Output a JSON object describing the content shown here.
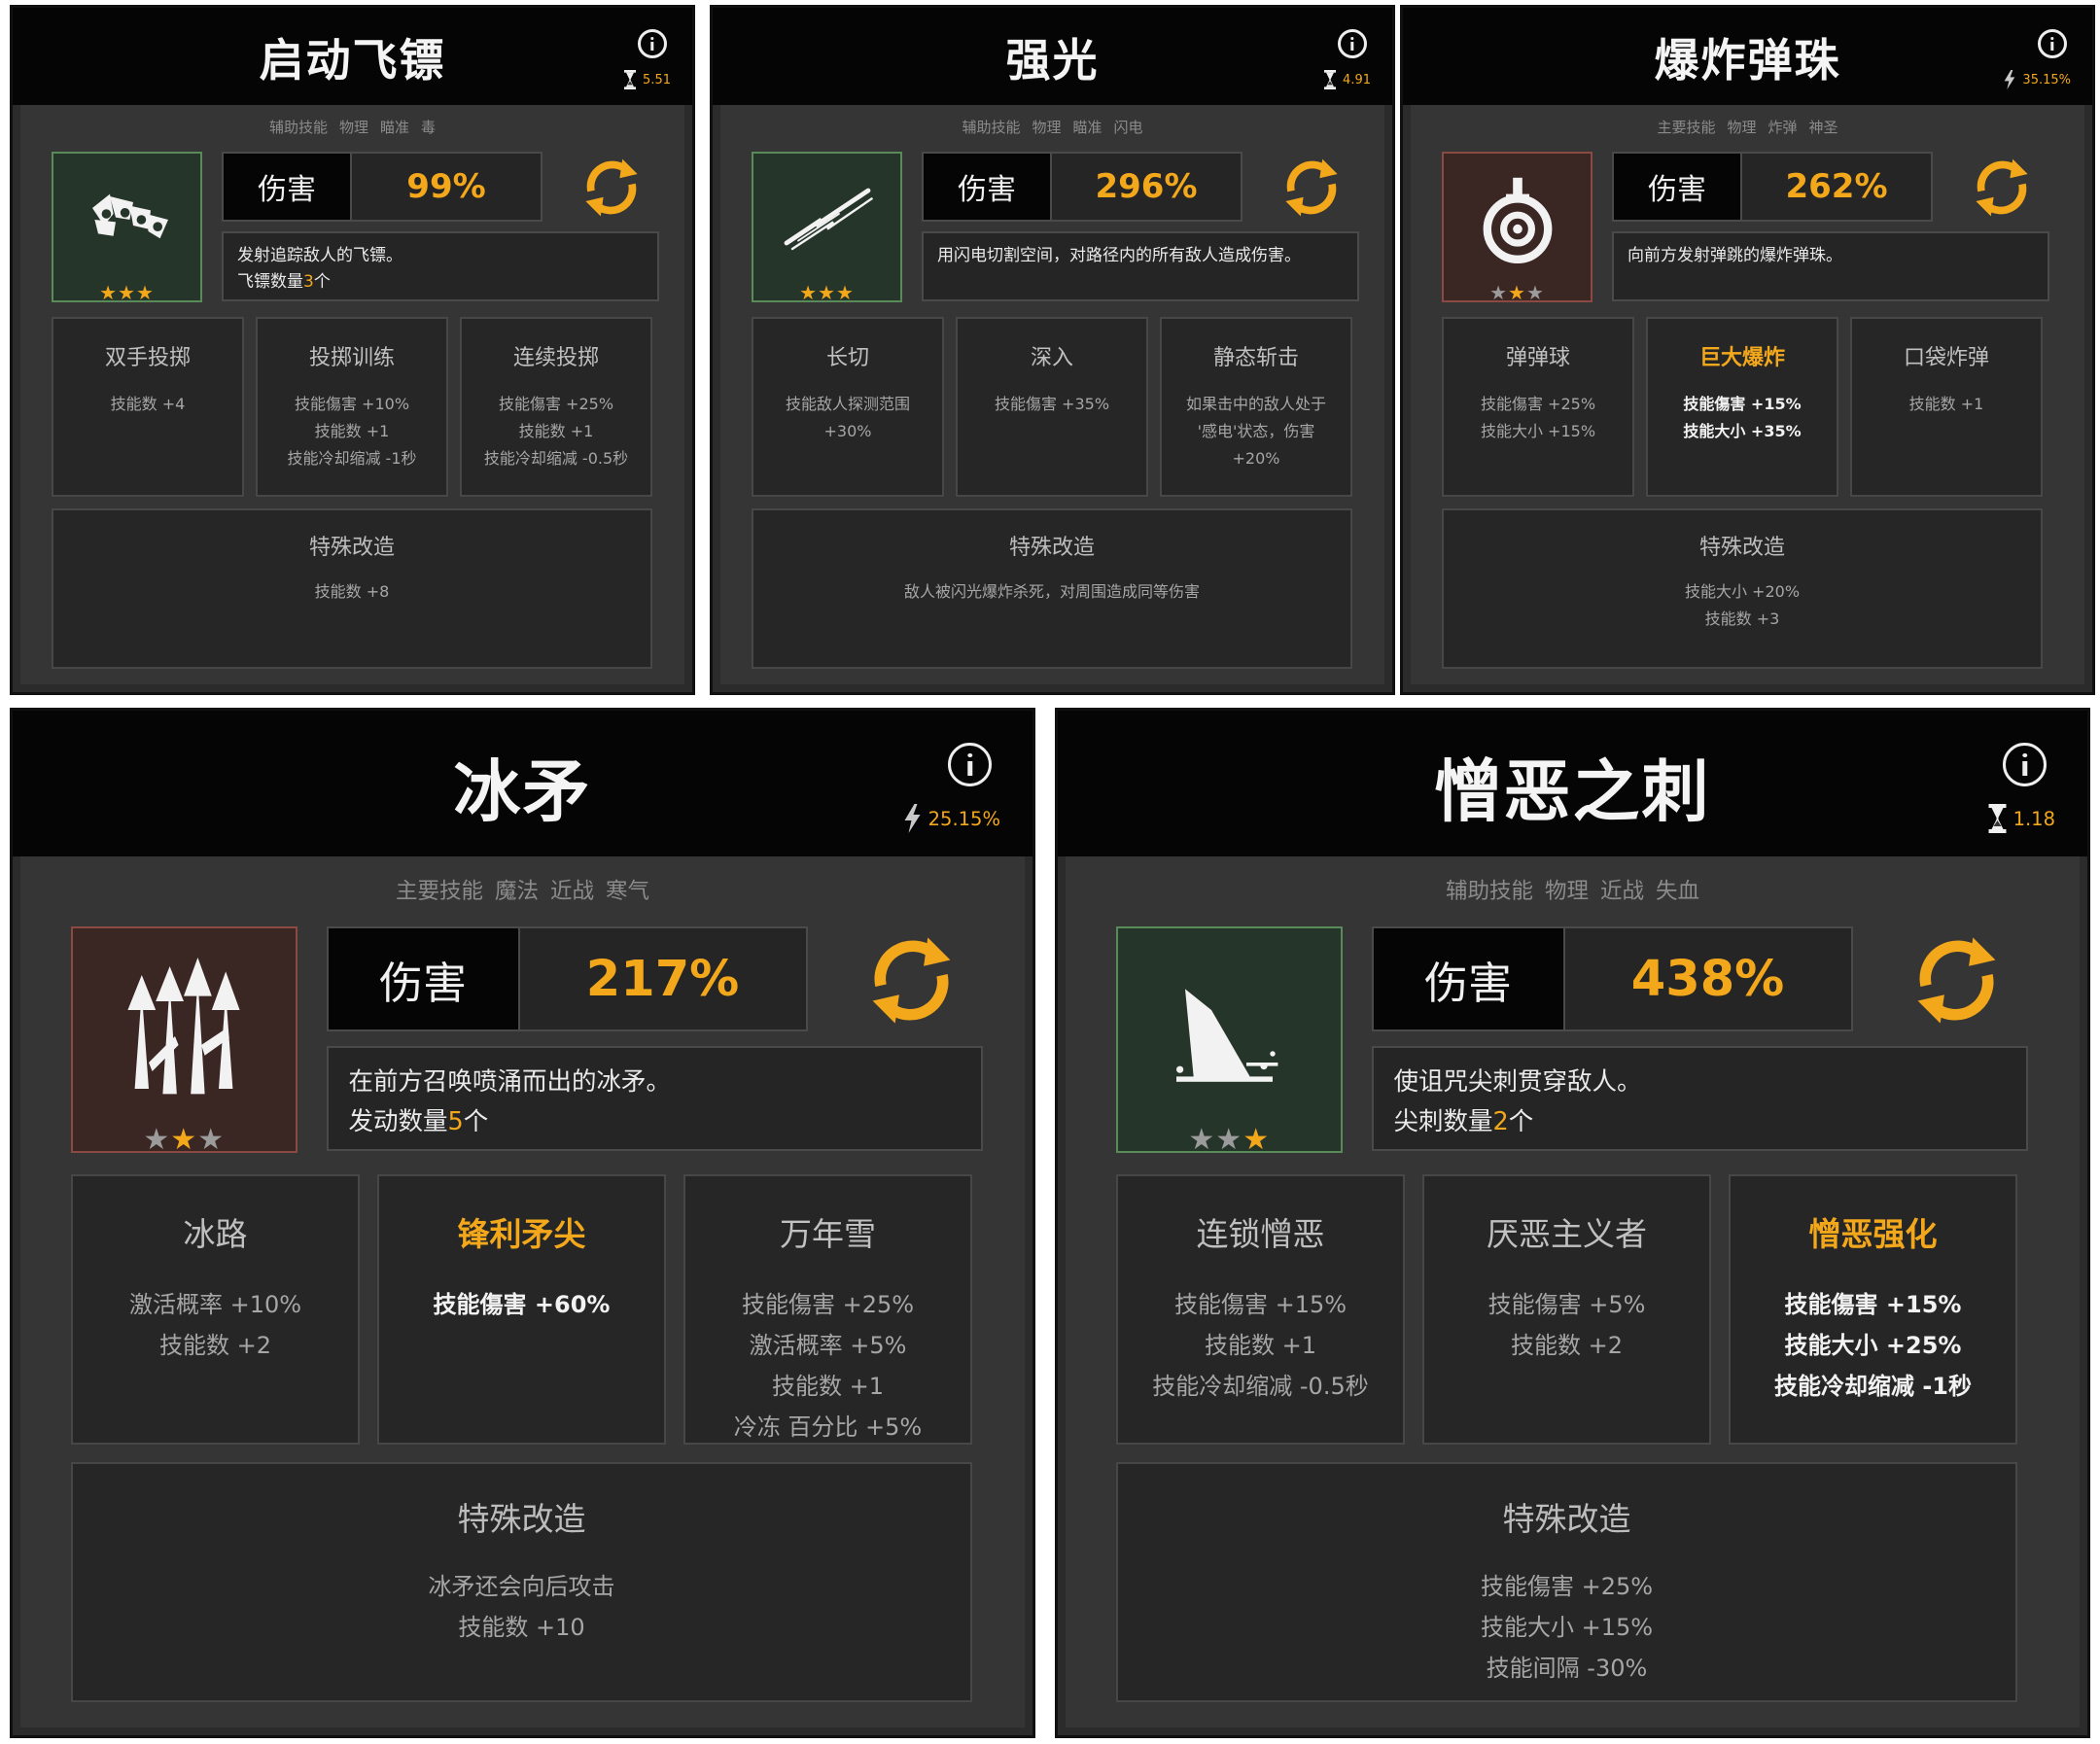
{
  "accent_color": "#f3a81c",
  "cards": [
    {
      "title": "启动飞镖",
      "stat_icon": "hourglass-icon",
      "stat_value": "5.51",
      "tags": [
        "辅助技能",
        "物理",
        "瞄准",
        "毒"
      ],
      "icon_name": "shuriken-icon",
      "icon_frame": "green",
      "stars": [
        true,
        true,
        true
      ],
      "damage_label": "伤害",
      "damage_value": "99%",
      "description": [
        "发射追踪敌人的飞镖。",
        "飞镖数量",
        "3",
        "个"
      ],
      "mods": [
        {
          "name": "双手投掷",
          "lines": [
            "技能数 +4"
          ],
          "highlight": false
        },
        {
          "name": "投掷训练",
          "lines": [
            "技能傷害 +10%",
            "技能数 +1",
            "技能冷却缩减 -1秒"
          ],
          "highlight": false
        },
        {
          "name": "连续投掷",
          "lines": [
            "技能傷害 +25%",
            "技能数 +1",
            "技能冷却缩减 -0.5秒"
          ],
          "highlight": false
        }
      ],
      "special_title": "特殊改造",
      "special_lines": [
        "技能数 +8"
      ]
    },
    {
      "title": "强光",
      "stat_icon": "hourglass-icon",
      "stat_value": "4.91",
      "tags": [
        "辅助技能",
        "物理",
        "瞄准",
        "闪电"
      ],
      "icon_name": "lightning-slash-icon",
      "icon_frame": "green",
      "stars": [
        true,
        true,
        true
      ],
      "damage_label": "伤害",
      "damage_value": "296%",
      "description": [
        "用闪电切割空间，对路径内的所有敌人造成伤害。"
      ],
      "mods": [
        {
          "name": "长切",
          "lines": [
            "技能敌人探测范围",
            "+30%"
          ],
          "highlight": false
        },
        {
          "name": "深入",
          "lines": [
            "技能傷害 +35%"
          ],
          "highlight": false
        },
        {
          "name": "静态斩击",
          "lines": [
            "如果击中的敌人处于",
            "'感电'状态，伤害",
            "+20%"
          ],
          "highlight": false
        }
      ],
      "special_title": "特殊改造",
      "special_lines": [
        "敌人被闪光爆炸杀死，对周围造成同等伤害"
      ]
    },
    {
      "title": "爆炸弹珠",
      "stat_icon": "bolt-icon",
      "stat_value": "35.15%",
      "tags": [
        "主要技能",
        "物理",
        "炸弹",
        "神圣"
      ],
      "icon_name": "bomb-target-icon",
      "icon_frame": "red",
      "stars": [
        false,
        true,
        false
      ],
      "damage_label": "伤害",
      "damage_value": "262%",
      "description": [
        "向前方发射弹跳的爆炸弹珠。"
      ],
      "mods": [
        {
          "name": "弹弹球",
          "lines": [
            "技能傷害 +25%",
            "技能大小 +15%"
          ],
          "highlight": false
        },
        {
          "name": "巨大爆炸",
          "lines": [
            "技能傷害 +15%",
            "技能大小 +35%"
          ],
          "highlight": true
        },
        {
          "name": "口袋炸弹",
          "lines": [
            "技能数 +1"
          ],
          "highlight": false
        }
      ],
      "special_title": "特殊改造",
      "special_lines": [
        "技能大小 +20%",
        "技能数 +3"
      ]
    },
    {
      "title": "冰矛",
      "stat_icon": "bolt-icon",
      "stat_value": "25.15%",
      "tags": [
        "主要技能",
        "魔法",
        "近战",
        "寒气"
      ],
      "icon_name": "ice-spears-icon",
      "icon_frame": "red",
      "stars": [
        false,
        true,
        false
      ],
      "damage_label": "伤害",
      "damage_value": "217%",
      "description": [
        "在前方召唤喷涌而出的冰矛。",
        "发动数量",
        "5",
        "个"
      ],
      "mods": [
        {
          "name": "冰路",
          "lines": [
            "激活概率 +10%",
            "技能数 +2"
          ],
          "highlight": false
        },
        {
          "name": "锋利矛尖",
          "lines": [
            "技能傷害 +60%"
          ],
          "highlight": true
        },
        {
          "name": "万年雪",
          "lines": [
            "技能傷害 +25%",
            "激活概率 +5%",
            "技能数 +1",
            "冷冻 百分比 +5%"
          ],
          "highlight": false
        }
      ],
      "special_title": "特殊改造",
      "special_lines": [
        "冰矛还会向后攻击",
        "技能数 +10"
      ]
    },
    {
      "title": "憎恶之刺",
      "stat_icon": "hourglass-icon",
      "stat_value": "1.18",
      "tags": [
        "辅助技能",
        "物理",
        "近战",
        "失血"
      ],
      "icon_name": "thorn-spike-icon",
      "icon_frame": "green",
      "stars": [
        false,
        false,
        true
      ],
      "damage_label": "伤害",
      "damage_value": "438%",
      "description": [
        "使诅咒尖刺贯穿敌人。",
        "尖刺数量",
        "2",
        "个"
      ],
      "mods": [
        {
          "name": "连锁憎恶",
          "lines": [
            "技能傷害 +15%",
            "技能数 +1",
            "技能冷却缩减 -0.5秒"
          ],
          "highlight": false
        },
        {
          "name": "厌恶主义者",
          "lines": [
            "技能傷害 +5%",
            "技能数 +2"
          ],
          "highlight": false
        },
        {
          "name": "憎恶强化",
          "lines": [
            "技能傷害 +15%",
            "技能大小 +25%",
            "技能冷却缩减 -1秒"
          ],
          "highlight": true
        }
      ],
      "special_title": "特殊改造",
      "special_lines": [
        "技能傷害 +25%",
        "技能大小 +15%",
        "技能间隔 -30%"
      ]
    }
  ]
}
